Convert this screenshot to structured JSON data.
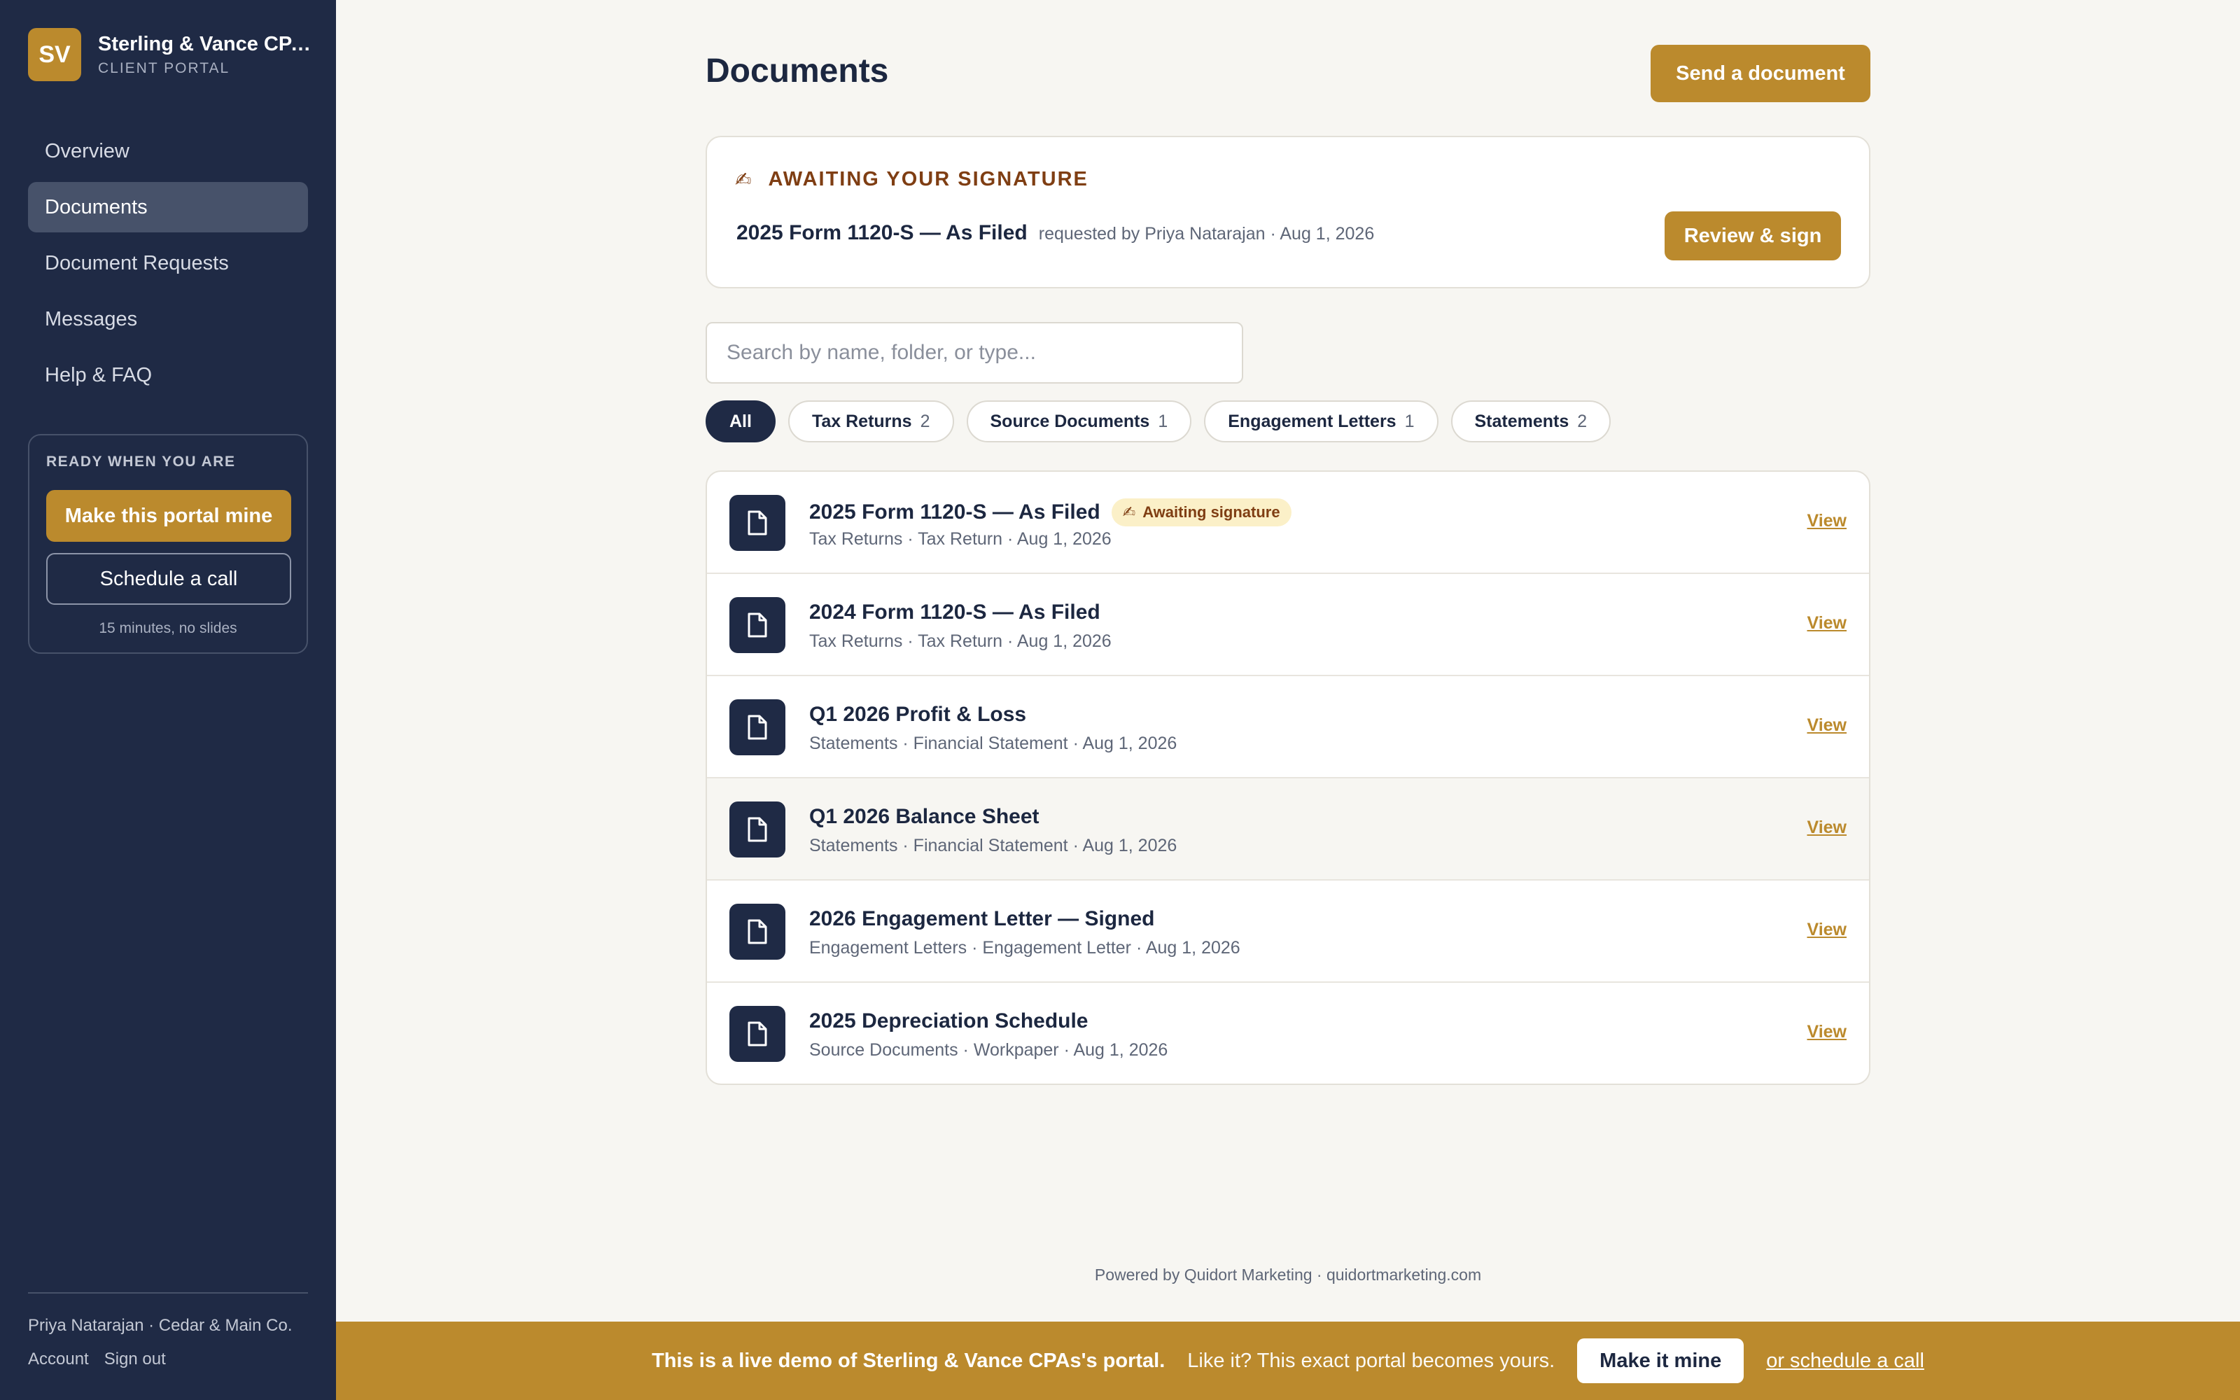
{
  "brand": {
    "initials": "SV",
    "name": "Sterling & Vance CPAs",
    "subtitle": "CLIENT PORTAL"
  },
  "nav": [
    {
      "label": "Overview",
      "active": false
    },
    {
      "label": "Documents",
      "active": true
    },
    {
      "label": "Document Requests",
      "active": false
    },
    {
      "label": "Messages",
      "active": false
    },
    {
      "label": "Help & FAQ",
      "active": false
    }
  ],
  "promo": {
    "title": "READY WHEN YOU ARE",
    "primary_label": "Make this portal mine",
    "secondary_label": "Schedule a call",
    "note": "15 minutes, no slides"
  },
  "user": {
    "line": "Priya Natarajan · Cedar & Main Co.",
    "account_label": "Account",
    "signout_label": "Sign out"
  },
  "page": {
    "title": "Documents",
    "send_label": "Send a document"
  },
  "signature": {
    "icon": "writing-hand-icon",
    "heading": "AWAITING YOUR SIGNATURE",
    "doc_name": "2025 Form 1120-S — As Filed",
    "meta": "requested by Priya Natarajan · Aug 1, 2026",
    "button_label": "Review & sign"
  },
  "search": {
    "placeholder": "Search by name, folder, or type...",
    "value": ""
  },
  "filters": [
    {
      "label": "All",
      "count": "",
      "active": true
    },
    {
      "label": "Tax Returns",
      "count": "2",
      "active": false
    },
    {
      "label": "Source Documents",
      "count": "1",
      "active": false
    },
    {
      "label": "Engagement Letters",
      "count": "1",
      "active": false
    },
    {
      "label": "Statements",
      "count": "2",
      "active": false
    }
  ],
  "documents": [
    {
      "title": "2025 Form 1120-S — As Filed",
      "meta": "Tax Returns · Tax Return · Aug 1, 2026",
      "badge": "Awaiting signature",
      "view": "View"
    },
    {
      "title": "2024 Form 1120-S — As Filed",
      "meta": "Tax Returns · Tax Return · Aug 1, 2026",
      "badge": "",
      "view": "View"
    },
    {
      "title": "Q1 2026 Profit & Loss",
      "meta": "Statements · Financial Statement · Aug 1, 2026",
      "badge": "",
      "view": "View"
    },
    {
      "title": "Q1 2026 Balance Sheet",
      "meta": "Statements · Financial Statement · Aug 1, 2026",
      "badge": "",
      "view": "View"
    },
    {
      "title": "2026 Engagement Letter — Signed",
      "meta": "Engagement Letters · Engagement Letter · Aug 1, 2026",
      "badge": "",
      "view": "View"
    },
    {
      "title": "2025 Depreciation Schedule",
      "meta": "Source Documents · Workpaper · Aug 1, 2026",
      "badge": "",
      "view": "View"
    }
  ],
  "footer": {
    "powered": "Powered by Quidort Marketing · quidortmarketing.com"
  },
  "banner": {
    "main": "This is a live demo of Sterling & Vance CPAs's portal.",
    "sub": "Like it? This exact portal becomes yours.",
    "button_label": "Make it mine",
    "link_label": "or schedule a call"
  },
  "colors": {
    "navy": "#1f2a45",
    "gold": "#bb8a2d",
    "background": "#f7f6f2"
  }
}
